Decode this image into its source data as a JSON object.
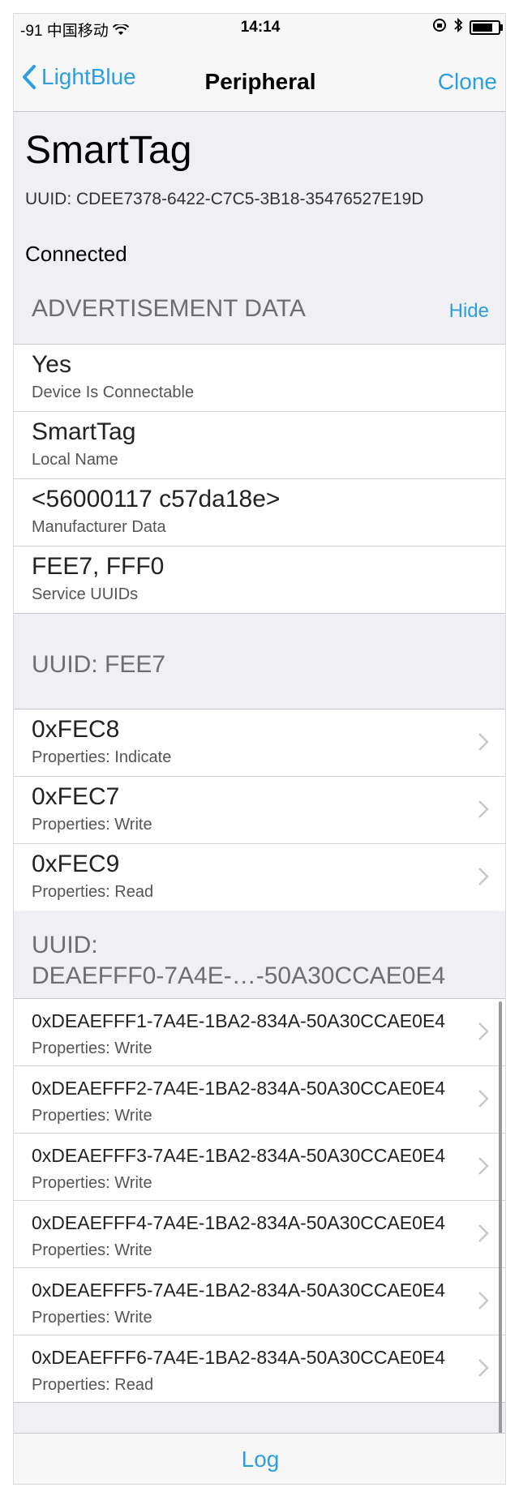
{
  "status": {
    "carrier": "-91 中国移动",
    "time": "14:14"
  },
  "nav": {
    "back_label": "LightBlue",
    "title": "Peripheral",
    "action_label": "Clone"
  },
  "peripheral": {
    "name": "SmartTag",
    "uuid": "UUID: CDEE7378-6422-C7C5-3B18-35476527E19D",
    "state": "Connected"
  },
  "advertisement": {
    "header": "ADVERTISEMENT DATA",
    "hide_label": "Hide",
    "items": [
      {
        "value": "Yes",
        "label": "Device Is Connectable"
      },
      {
        "value": "SmartTag",
        "label": "Local Name"
      },
      {
        "value": "<56000117 c57da18e>",
        "label": "Manufacturer Data"
      },
      {
        "value": "FEE7, FFF0",
        "label": "Service UUIDs"
      }
    ]
  },
  "service_fee7": {
    "header": "UUID: FEE7",
    "characteristics": [
      {
        "uuid": "0xFEC8",
        "props": "Properties: Indicate"
      },
      {
        "uuid": "0xFEC7",
        "props": "Properties: Write"
      },
      {
        "uuid": "0xFEC9",
        "props": "Properties: Read"
      }
    ]
  },
  "service_deaefff0": {
    "header_line1": "UUID:",
    "header_line2": "DEAEFFF0-7A4E-…-50A30CCAE0E4",
    "characteristics": [
      {
        "uuid": "0xDEAEFFF1-7A4E-1BA2-834A-50A30CCAE0E4",
        "props": "Properties: Write"
      },
      {
        "uuid": "0xDEAEFFF2-7A4E-1BA2-834A-50A30CCAE0E4",
        "props": "Properties: Write"
      },
      {
        "uuid": "0xDEAEFFF3-7A4E-1BA2-834A-50A30CCAE0E4",
        "props": "Properties: Write"
      },
      {
        "uuid": "0xDEAEFFF4-7A4E-1BA2-834A-50A30CCAE0E4",
        "props": "Properties: Write"
      },
      {
        "uuid": "0xDEAEFFF5-7A4E-1BA2-834A-50A30CCAE0E4",
        "props": "Properties: Write"
      },
      {
        "uuid": "0xDEAEFFF6-7A4E-1BA2-834A-50A30CCAE0E4",
        "props": "Properties: Read"
      }
    ]
  },
  "tabbar": {
    "log_label": "Log"
  },
  "colors": {
    "accent": "#2d9ee0",
    "group_bg": "#efeff4"
  }
}
